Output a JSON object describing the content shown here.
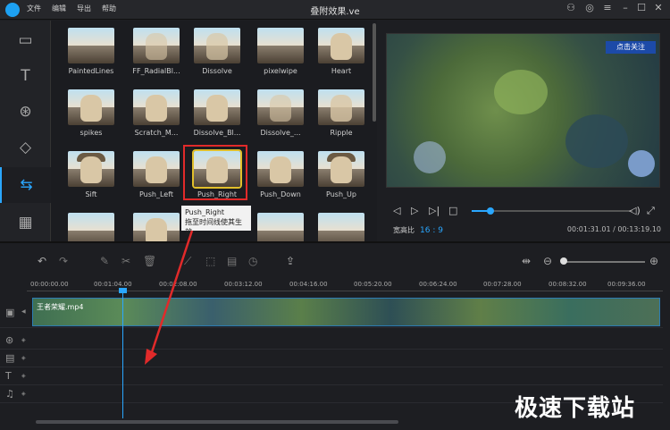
{
  "window": {
    "title": "叠附效果.ve",
    "menu": [
      "文件",
      "编辑",
      "导出",
      "帮助"
    ]
  },
  "sidebar": {
    "items": [
      {
        "name": "media",
        "glyph": "▭"
      },
      {
        "name": "text",
        "glyph": "T"
      },
      {
        "name": "filters",
        "glyph": "⊛"
      },
      {
        "name": "overlay",
        "glyph": "◇"
      },
      {
        "name": "transitions",
        "glyph": "⇆"
      },
      {
        "name": "elements",
        "glyph": "▦"
      }
    ]
  },
  "transitions": [
    [
      "PaintedLines",
      "FF_RadialBl...",
      "Dissolve",
      "pixelwipe",
      "Heart"
    ],
    [
      "spikes",
      "Scratch_M...",
      "Dissolve_Bl...",
      "Dissolve_...",
      "Ripple"
    ],
    [
      "Sift",
      "Push_Left",
      "Push_Right",
      "Push_Down",
      "Push_Up"
    ]
  ],
  "tooltip": {
    "title": "Push_Right",
    "hint": "拖至时间线使其生效"
  },
  "player": {
    "aspect_label": "宽高比",
    "aspect_value": "16 : 9",
    "time": "00:01:31.01 / 00:13:19.10",
    "overlay_text": "点击关注"
  },
  "timeline": {
    "ticks": [
      "00:00:00.00",
      "00:01:04.00",
      "00:02:08.00",
      "00:03:12.00",
      "00:04:16.00",
      "00:05:20.00",
      "00:06:24.00",
      "00:07:28.00",
      "00:08:32.00",
      "00:09:36.00"
    ],
    "clip_name": "王者荣耀.mp4"
  },
  "watermark": "极速下载站"
}
